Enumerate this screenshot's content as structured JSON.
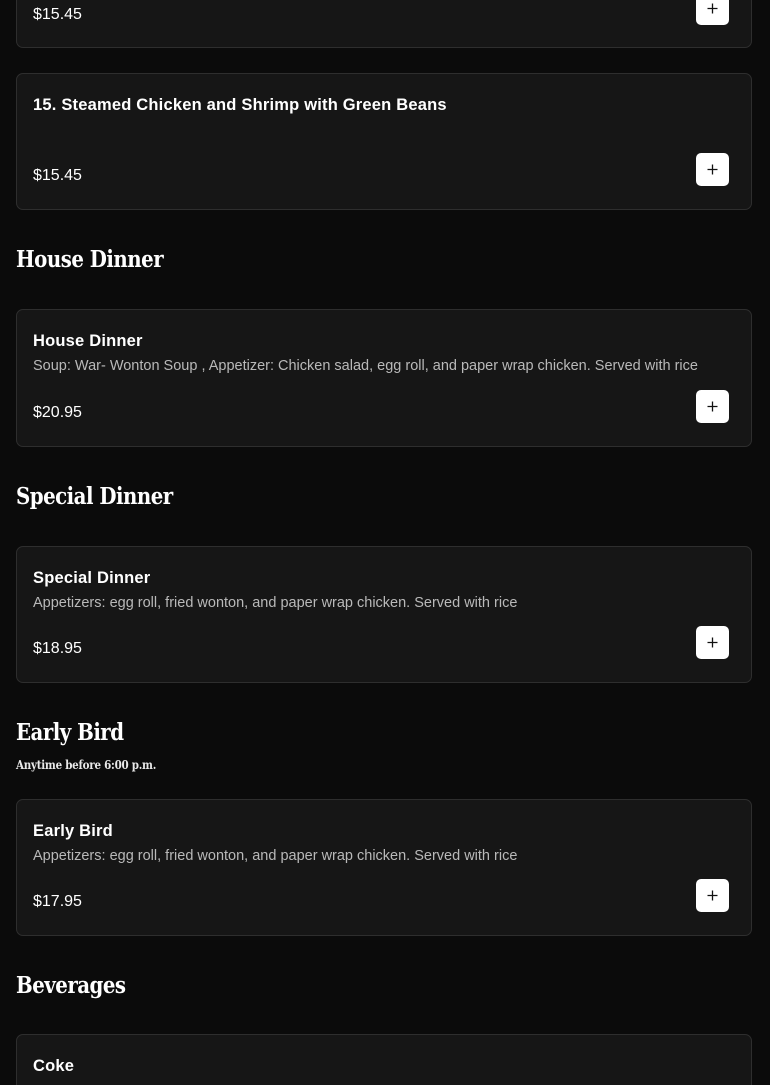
{
  "items": {
    "steamed_chicken_broccoli": {
      "price": "$15.45"
    },
    "steamed_chicken_shrimp_green_beans": {
      "name": "15. Steamed Chicken and Shrimp with Green Beans",
      "price": "$15.45"
    },
    "house_dinner": {
      "name": "House Dinner",
      "description": "Soup: War- Wonton Soup , Appetizer: Chicken salad, egg roll, and paper wrap chicken. Served with rice",
      "price": "$20.95"
    },
    "special_dinner": {
      "name": "Special Dinner",
      "description": "Appetizers: egg roll, fried wonton, and paper wrap chicken. Served with rice",
      "price": "$18.95"
    },
    "early_bird": {
      "name": "Early Bird",
      "description": "Appetizers: egg roll, fried wonton, and paper wrap chicken. Served with rice",
      "price": "$17.95"
    },
    "coke": {
      "name": "Coke"
    }
  },
  "sections": {
    "house_dinner": {
      "title": "House Dinner"
    },
    "special_dinner": {
      "title": "Special Dinner"
    },
    "early_bird": {
      "title": "Early Bird",
      "subtitle": "Anytime before 6:00 p.m."
    },
    "beverages": {
      "title": "Beverages"
    }
  },
  "icons": {
    "add": "plus-icon"
  },
  "colors": {
    "background": "#0b0b0b",
    "card": "#161616",
    "card_border": "#2e2e2e",
    "text": "#ffffff",
    "muted_text": "#b9b9b9",
    "button": "#ffffff"
  }
}
